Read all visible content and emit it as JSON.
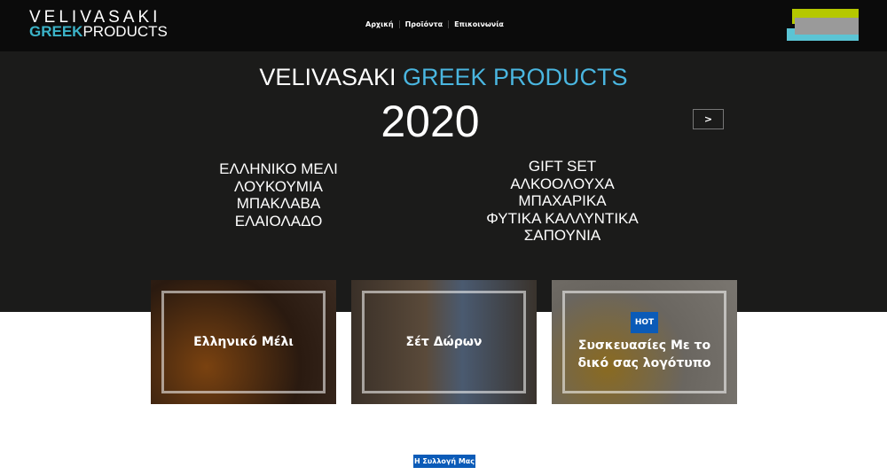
{
  "header": {
    "logo_line1": "VELIVASAKI",
    "logo_greek": "GREEK",
    "logo_products": "PRODUCTS",
    "nav": [
      "Αρχική",
      "Προϊόντα",
      "Επικοινωνία"
    ]
  },
  "hero": {
    "title_white": "VELIVASAKI",
    "title_blue": "GREEK PRODUCTS",
    "year": "2020",
    "next_label": ">",
    "left_list": [
      "ΕΛΛΗΝΙΚΟ ΜΕΛΙ",
      "ΛΟΥΚΟΥΜΙΑ",
      "ΜΠΑΚΛΑΒΑ",
      "ΕΛΑΙΟΛΑΔΟ"
    ],
    "right_list": [
      "GIFT SET",
      "ΑΛΚΟΟΛΟΥΧΑ",
      "ΜΠΑΧΑΡΙΚΑ",
      "ΦΥΤΙΚΑ ΚΑΛΛΥΝΤΙΚΑ",
      "ΣΑΠΟΥΝΙΑ"
    ]
  },
  "cards": [
    {
      "label": "Ελληνικό Μέλι"
    },
    {
      "label": "Σέτ Δώρων"
    },
    {
      "label": "Συσκευασίες Με το δικό σας λογότυπο",
      "badge": "HOT"
    }
  ],
  "collection_button": "Η Συλλογή Μας",
  "colors": {
    "accent": "#3bb3c8",
    "button": "#0b5bb8",
    "hero_bg": "#1b1b1a"
  }
}
